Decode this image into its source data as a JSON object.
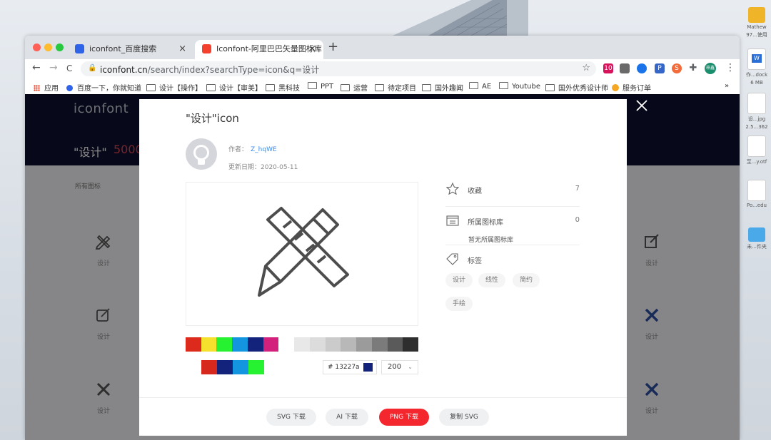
{
  "desktop": {
    "icons": [
      {
        "label": "Mathew",
        "sub": "97...使用",
        "color": "#f0b429"
      },
      {
        "label": "作...dock",
        "sub": "6 MB",
        "color": "#2b6fd6"
      },
      {
        "label": "设...jpg",
        "sub": "2.5...362",
        "color": "#e9e9e9"
      },
      {
        "label": "至...y.otf",
        "sub": "",
        "color": "#e4e4e4"
      },
      {
        "label": "Po...edu",
        "sub": "",
        "color": "#f4f4f4"
      },
      {
        "label": "未...件夹",
        "sub": "",
        "color": "#4aa9e8"
      }
    ]
  },
  "browser": {
    "tabs": [
      {
        "title": "iconfont_百度搜索",
        "close": "×"
      },
      {
        "title": "Iconfont-阿里巴巴矢量图标库",
        "close": "×"
      }
    ],
    "new_tab": "+",
    "nav": {
      "back": "←",
      "forward": "→",
      "reload": "C"
    },
    "url_host": "iconfont.cn",
    "url_path": "/search/index?searchType=icon&q=设计",
    "bookmark_star": "☆",
    "extensions": [
      {
        "name": "ext-10",
        "text": "10",
        "color": "#d6135b"
      },
      {
        "name": "ext-shield",
        "text": "",
        "color": "#6a6a6a"
      },
      {
        "name": "ext-google",
        "text": "",
        "color": "#1a73e8"
      },
      {
        "name": "ext-p",
        "text": "P",
        "color": "#3667c8"
      },
      {
        "name": "ext-s",
        "text": "S",
        "color": "#f26b3a"
      },
      {
        "name": "ext-puzzle",
        "text": "",
        "color": "#5f6368"
      },
      {
        "name": "ext-profile",
        "text": "梓鑫",
        "color": "#1b8e6e"
      }
    ],
    "menu": "⋮",
    "bookmarks": [
      "应用",
      "百度一下，你就知道",
      "设计【操作】",
      "设计【审美】",
      "黑科技",
      "PPT",
      "运营",
      "待定项目",
      "国外趣闻",
      "AE",
      "Youtube",
      "国外优秀设计师",
      "服务订单"
    ],
    "bookmarks_more": "»"
  },
  "page": {
    "logo": "iconfont",
    "title": "\"设计\"",
    "count": "5000",
    "filter": "所有图标",
    "bg_icon_label": "设计"
  },
  "modal": {
    "title": "\"设计\"icon",
    "author_prefix": "作者：",
    "author": "Z_hqWE",
    "date": "更新日期：2020-05-11",
    "favorite_label": "收藏",
    "favorite_count": "7",
    "library_label": "所属图标库",
    "library_count": "0",
    "library_note": "暂无所属图标库",
    "tags_label": "标签",
    "tags": [
      "设计",
      "线性",
      "简约",
      "手绘"
    ],
    "palette": [
      "#dc2a1d",
      "#f5e12d",
      "#27f232",
      "#1495e0",
      "#13227a",
      "#d3207d",
      "#ffffff",
      "#e8e8e8",
      "#dcdcdc",
      "#cbcbcb",
      "#b8b8b8",
      "#9b9b9b",
      "#7b7b7b",
      "#5a5a5a",
      "#2e2e2e"
    ],
    "recent_colors": [
      "#ffffff",
      "#d6281c",
      "#13227a",
      "#1495e0",
      "#27f232"
    ],
    "hex_prefix": "#",
    "hex": "13227a",
    "hex_color": "#13227a",
    "size": "200",
    "size_caret": "⌄",
    "buttons": {
      "svg": "SVG 下载",
      "ai": "AI 下载",
      "png": "PNG 下载",
      "copy": "复制 SVG"
    }
  }
}
